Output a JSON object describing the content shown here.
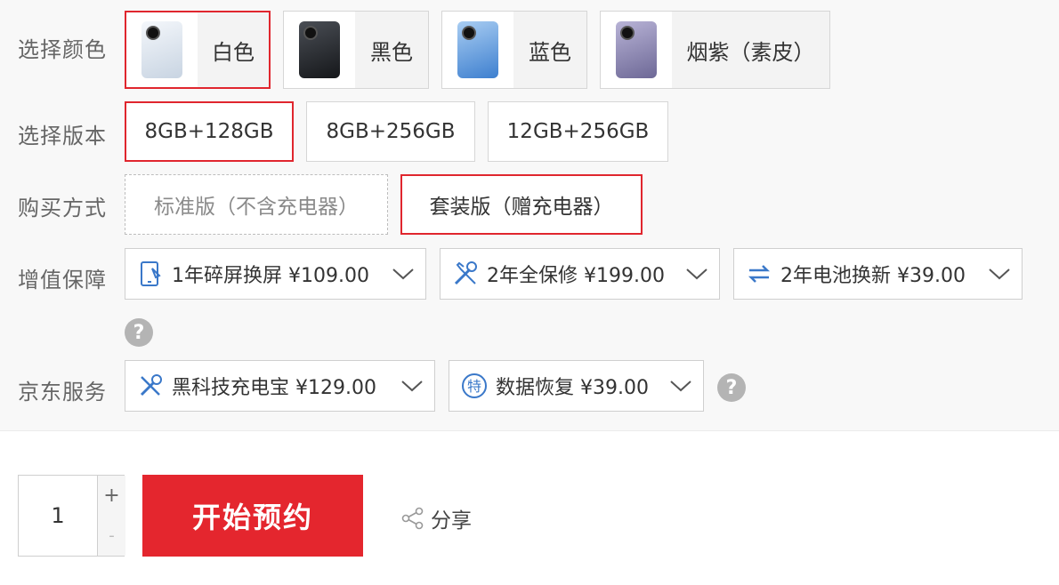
{
  "colors": {
    "label": "选择颜色",
    "options": [
      {
        "name": "白色",
        "phone_color": "#dfe6ef",
        "selected": true
      },
      {
        "name": "黑色",
        "phone_color": "#2a2c30",
        "selected": false
      },
      {
        "name": "蓝色",
        "phone_color": "#6fa7e3",
        "selected": false
      },
      {
        "name": "烟紫（素皮）",
        "phone_color": "#8f8bb3",
        "selected": false
      }
    ]
  },
  "versions": {
    "label": "选择版本",
    "options": [
      "8GB+128GB",
      "8GB+256GB",
      "12GB+256GB"
    ],
    "selected": "8GB+128GB"
  },
  "purchase": {
    "label": "购买方式",
    "options": [
      "标准版（不含充电器）",
      "套装版（赠充电器）"
    ],
    "selected": "套装版（赠充电器）"
  },
  "warranty": {
    "label": "增值保障",
    "items": [
      {
        "icon": "phone-screen-icon",
        "text": "1年碎屏换屏 ¥109.00"
      },
      {
        "icon": "wrench-screwdriver-icon",
        "text": "2年全保修 ¥199.00"
      },
      {
        "icon": "battery-swap-icon",
        "text": "2年电池换新 ¥39.00"
      }
    ]
  },
  "jd_service": {
    "label": "京东服务",
    "items": [
      {
        "icon": "tools-icon",
        "text": "黑科技充电宝 ¥129.00"
      },
      {
        "icon": "special-badge-icon",
        "text": "数据恢复 ¥39.00",
        "badge": "特"
      }
    ]
  },
  "help_mark": "?",
  "quantity": {
    "value": "1",
    "plus": "+",
    "minus": "-"
  },
  "buy_button": "开始预约",
  "share_label": "分享",
  "accent_color": "#e4262e"
}
